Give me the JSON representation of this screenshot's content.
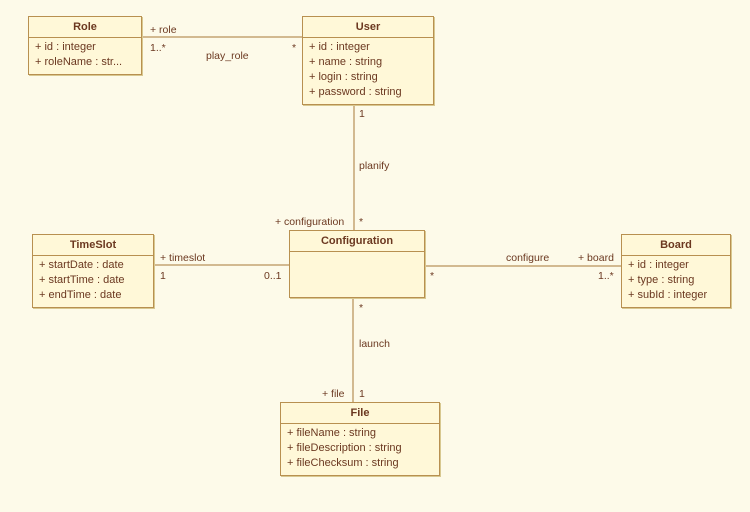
{
  "classes": {
    "role": {
      "name": "Role",
      "attrs": [
        "+ id : integer",
        "+ roleName : str..."
      ]
    },
    "user": {
      "name": "User",
      "attrs": [
        "+ id : integer",
        "+ name : string",
        "+ login : string",
        "+ password : string"
      ]
    },
    "timeslot": {
      "name": "TimeSlot",
      "attrs": [
        "+ startDate : date",
        "+ startTime : date",
        "+ endTime : date"
      ]
    },
    "configuration": {
      "name": "Configuration",
      "attrs": []
    },
    "board": {
      "name": "Board",
      "attrs": [
        "+ id : integer",
        "+ type : string",
        "+ subId : integer"
      ]
    },
    "file": {
      "name": "File",
      "attrs": [
        "+ fileName : string",
        "+ fileDescription : string",
        "+ fileChecksum : string"
      ]
    }
  },
  "assoc": {
    "play_role": {
      "name": "play_role",
      "endA": "+ role",
      "multA": "1..*",
      "endB": "",
      "multB": "*"
    },
    "planify": {
      "name": "planify",
      "endA": "",
      "multA": "1",
      "endB": "+ configuration",
      "multB": "*"
    },
    "timeslot": {
      "name": "",
      "endA": "+ timeslot",
      "multA": "1",
      "endB": "",
      "multB": "0..1"
    },
    "configure": {
      "name": "configure",
      "endA": "",
      "multA": "*",
      "endB": "+ board",
      "multB": "1..*"
    },
    "launch": {
      "name": "launch",
      "endA": "",
      "multA": "*",
      "endB": "+ file",
      "multB": "1"
    }
  }
}
